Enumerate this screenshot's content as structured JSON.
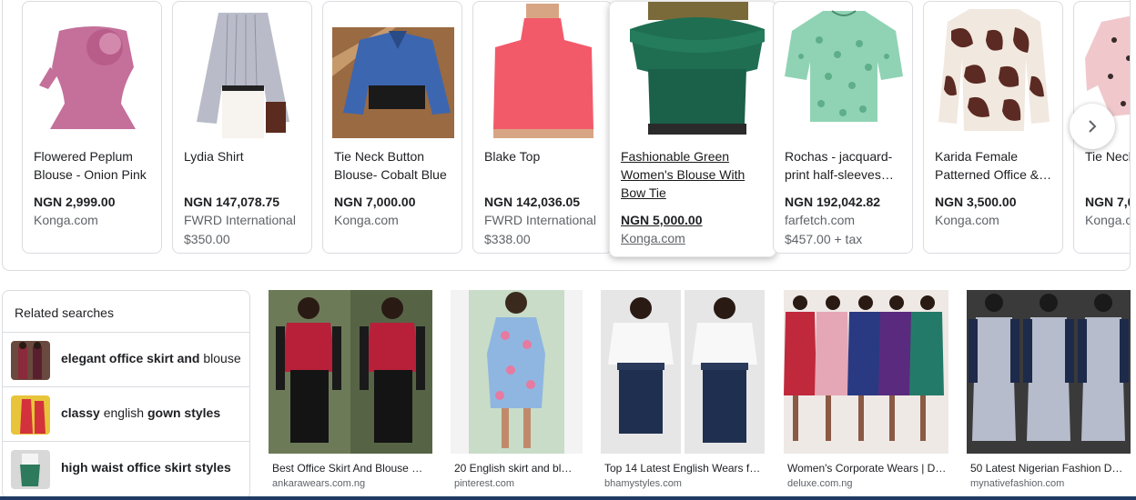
{
  "products": [
    {
      "title": "Flowered Peplum Blouse - Onion Pink",
      "price": "NGN 2,999.00",
      "store": "Konga.com",
      "sub": ""
    },
    {
      "title": "Lydia Shirt",
      "price": "NGN 147,078.75",
      "store": "FWRD International",
      "sub": "$350.00"
    },
    {
      "title": "Tie Neck Button Blouse- Cobalt Blue",
      "price": "NGN 7,000.00",
      "store": "Konga.com",
      "sub": ""
    },
    {
      "title": "Blake Top",
      "price": "NGN 142,036.05",
      "store": "FWRD International",
      "sub": "$338.00"
    },
    {
      "title": "Fashionable Green Women's Blouse With Bow Tie",
      "price": "NGN 5,000.00",
      "store": "Konga.com",
      "sub": ""
    },
    {
      "title": "Rochas - jacquard-print half-sleeves…",
      "price": "NGN 192,042.82",
      "store": "farfetch.com",
      "sub": "$457.00 + tax"
    },
    {
      "title": "Karida Female Patterned Office &…",
      "price": "NGN 3,500.00",
      "store": "Konga.com",
      "sub": ""
    },
    {
      "title": "Tie Neck Peach",
      "price": "NGN 7,0",
      "store": "Konga.c",
      "sub": ""
    }
  ],
  "carousel": {
    "next_icon": "chevron-right-icon"
  },
  "related": {
    "title": "Related searches",
    "items": [
      {
        "bold1": "elegant office skirt and",
        "plain": " blouse",
        "bold2": ""
      },
      {
        "bold1": "classy",
        "plain": " english ",
        "bold2": "gown styles"
      },
      {
        "bold1": "high waist office skirt styles",
        "plain": "",
        "bold2": ""
      }
    ]
  },
  "results": [
    {
      "title": "Best Office Skirt And Blouse …",
      "source": "ankarawears.com.ng"
    },
    {
      "title": "20 English skirt and bl…",
      "source": "pinterest.com"
    },
    {
      "title": "Top 14 Latest English Wears f…",
      "source": "bhamystyles.com"
    },
    {
      "title": "Women's Corporate Wears | D…",
      "source": "deluxe.com.ng"
    },
    {
      "title": "50 Latest Nigerian Fashion D…",
      "source": "mynativefashion.com"
    }
  ]
}
